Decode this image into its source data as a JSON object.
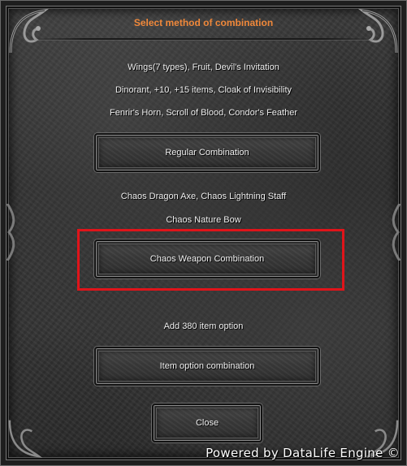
{
  "dialog": {
    "title": "Select method of combination",
    "title_color": "#f0883a"
  },
  "sections": {
    "regular": {
      "lines": [
        "Wings(7 types), Fruit, Devil's Invitation",
        "Dinorant, +10, +15 items, Cloak of Invisibility",
        "Fenrir's Horn, Scroll of Blood, Condor's Feather"
      ],
      "button_label": "Regular Combination"
    },
    "chaos_weapon": {
      "lines": [
        "Chaos Dragon Axe, Chaos Lightning Staff",
        "Chaos Nature Bow"
      ],
      "button_label": "Chaos Weapon Combination",
      "highlight_color": "#e0141a"
    },
    "item_option": {
      "lines": [
        "Add 380 item option"
      ],
      "button_label": "Item option combination"
    }
  },
  "close_button": {
    "label": "Close"
  },
  "watermark": {
    "text": "Powered by DataLife Engine ©"
  }
}
